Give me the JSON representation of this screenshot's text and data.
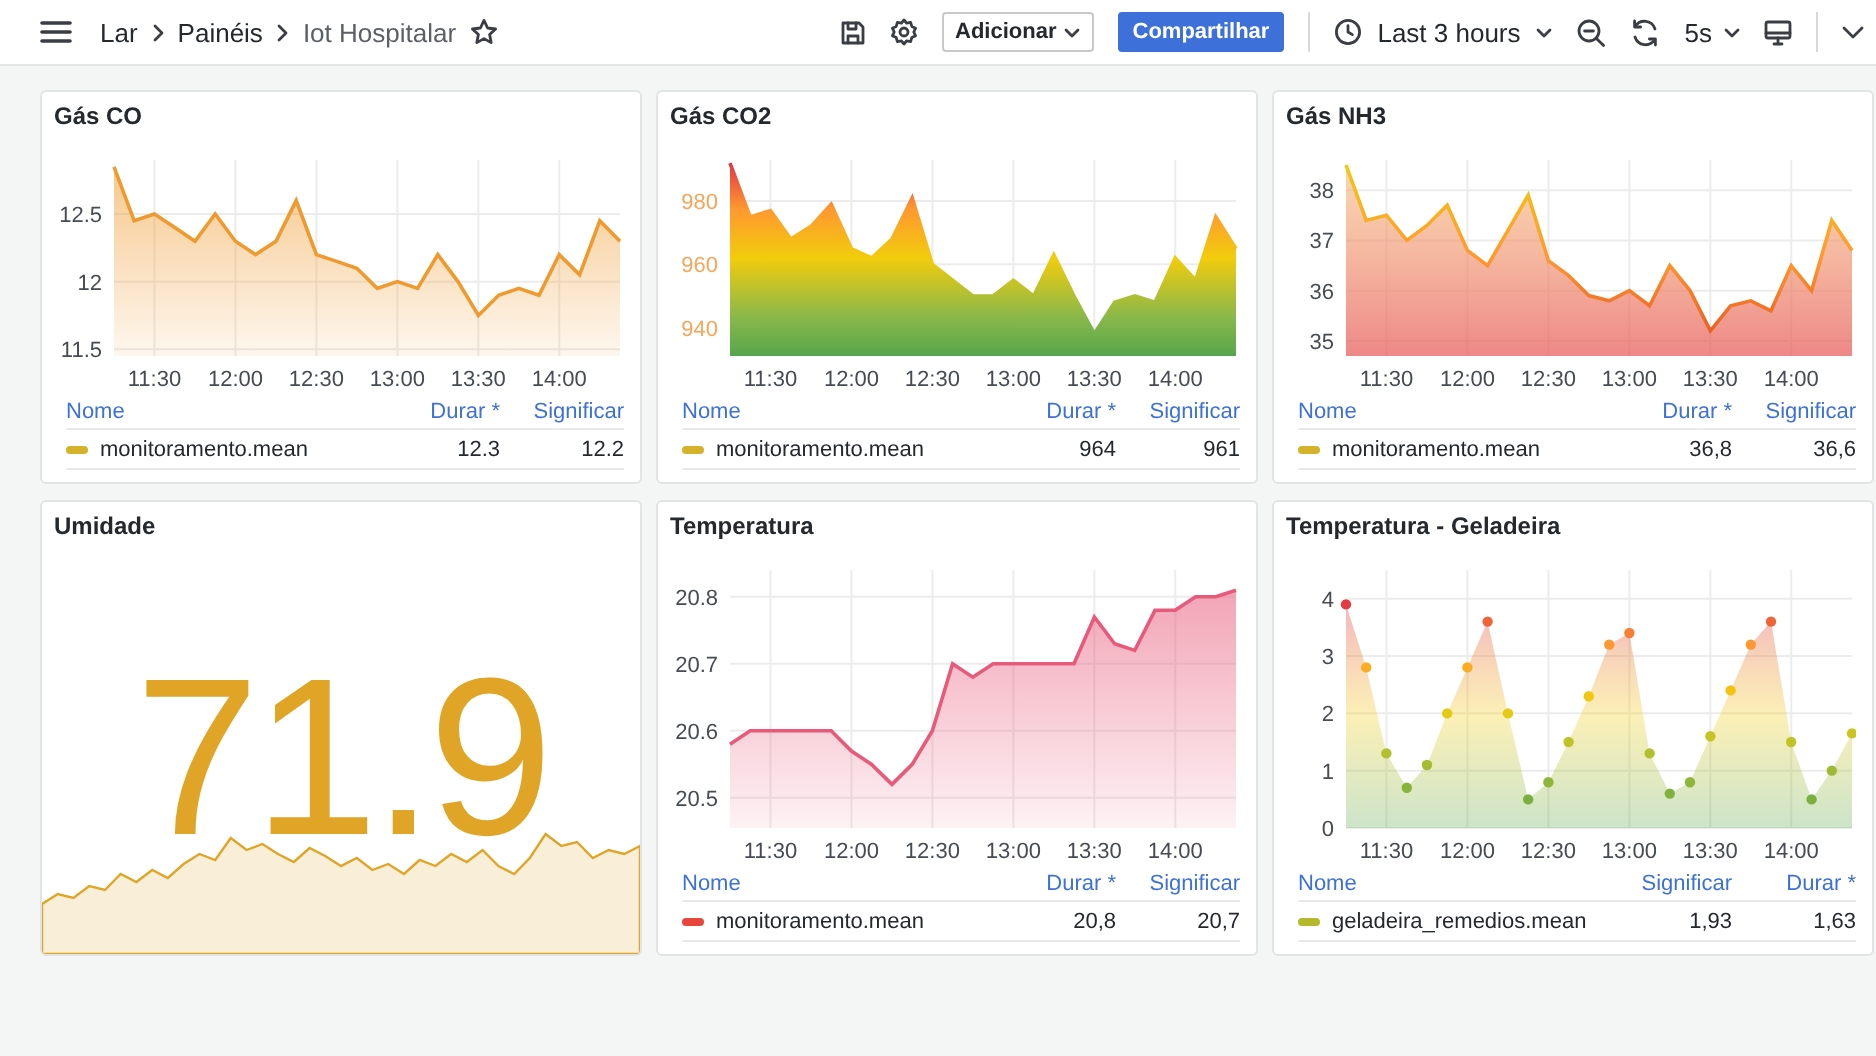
{
  "topbar": {
    "breadcrumbs": [
      {
        "label": "Lar",
        "current": false
      },
      {
        "label": "Painéis",
        "current": false
      },
      {
        "label": "Iot Hospitalar",
        "current": true
      }
    ],
    "add_button": "Adicionar",
    "share_button": "Compartilhar",
    "time_range": "Last 3 hours",
    "refresh_interval": "5s"
  },
  "panels": [
    {
      "kind": "area",
      "title": "Gás CO",
      "chart_data": {
        "type": "area",
        "categories": [
          null,
          null,
          "11:30",
          null,
          null,
          null,
          "12:00",
          null,
          null,
          null,
          "12:30",
          null,
          null,
          null,
          "13:00",
          null,
          null,
          null,
          "13:30",
          null,
          null,
          null,
          "14:00",
          null,
          null,
          null
        ],
        "series": [
          {
            "color": "#ef9a2f",
            "values": [
              12.85,
              12.45,
              12.5,
              12.4,
              12.3,
              12.5,
              12.3,
              12.2,
              12.3,
              12.6,
              12.2,
              12.15,
              12.1,
              11.95,
              12.0,
              11.95,
              12.2,
              12.0,
              11.75,
              11.9,
              11.95,
              11.9,
              12.2,
              12.05,
              12.45,
              12.3
            ]
          }
        ],
        "grid": true,
        "ylim": [
          11.45,
          12.9
        ],
        "yticks": [
          {
            "value": 11.5,
            "label": "11.5"
          },
          {
            "value": 12,
            "label": "12"
          },
          {
            "value": 12.5,
            "label": "12.5"
          }
        ]
      },
      "legend": {
        "columns": [
          "Nome",
          "Durar *",
          "Significar"
        ],
        "rows": [
          {
            "name": "monitoramento.mean",
            "color": "#d4b22a",
            "values": [
              "12.3",
              "12.2"
            ]
          }
        ]
      }
    },
    {
      "kind": "gradient",
      "title": "Gás CO2",
      "chart_data": {
        "type": "area",
        "categories": [
          null,
          null,
          "11:30",
          null,
          null,
          null,
          "12:00",
          null,
          null,
          null,
          "12:30",
          null,
          null,
          null,
          "13:00",
          null,
          null,
          null,
          "13:30",
          null,
          null,
          null,
          "14:00",
          null,
          null,
          null
        ],
        "series": [
          {
            "color": "#56a64b",
            "values": [
              992,
              975,
              977,
              968,
              972,
              979,
              965,
              962,
              968,
              981,
              960,
              955,
              950,
              950,
              955,
              950,
              963,
              950,
              938,
              948,
              950,
              948,
              962,
              955,
              975,
              965
            ]
          }
        ],
        "grid": true,
        "ylim": [
          931,
          993
        ],
        "yticks": [
          940,
          960,
          980
        ]
      },
      "legend": {
        "columns": [
          "Nome",
          "Durar *",
          "Significar"
        ],
        "rows": [
          {
            "name": "monitoramento.mean",
            "color": "#d4b22a",
            "values": [
              "964",
              "961"
            ]
          }
        ]
      }
    },
    {
      "kind": "gradient-line",
      "title": "Gás NH3",
      "chart_data": {
        "type": "area",
        "categories": [
          null,
          null,
          "11:30",
          null,
          null,
          null,
          "12:00",
          null,
          null,
          null,
          "12:30",
          null,
          null,
          null,
          "13:00",
          null,
          null,
          null,
          "13:30",
          null,
          null,
          null,
          "14:00",
          null,
          null,
          null
        ],
        "series": [
          {
            "color": "#e0501e",
            "values": [
              38.5,
              37.4,
              37.5,
              37.0,
              37.3,
              37.7,
              36.8,
              36.5,
              37.2,
              37.9,
              36.6,
              36.3,
              35.9,
              35.8,
              36.0,
              35.7,
              36.5,
              36.0,
              35.2,
              35.7,
              35.8,
              35.6,
              36.5,
              36.0,
              37.4,
              36.8
            ]
          }
        ],
        "grid": true,
        "ylim": [
          34.7,
          38.6
        ],
        "yticks": [
          35,
          36,
          37,
          38
        ]
      },
      "legend": {
        "columns": [
          "Nome",
          "Durar *",
          "Significar"
        ],
        "rows": [
          {
            "name": "monitoramento.mean",
            "color": "#d4b22a",
            "values": [
              "36,8",
              "36,6"
            ]
          }
        ]
      }
    },
    {
      "kind": "stat",
      "title": "Umidade",
      "value": "71.9",
      "color": "#e0a526"
    },
    {
      "kind": "area",
      "title": "Temperatura",
      "chart_data": {
        "type": "area",
        "categories": [
          null,
          null,
          "11:30",
          null,
          null,
          null,
          "12:00",
          null,
          null,
          null,
          "12:30",
          null,
          null,
          null,
          "13:00",
          null,
          null,
          null,
          "13:30",
          null,
          null,
          null,
          "14:00",
          null,
          null,
          null
        ],
        "series": [
          {
            "color": "#e85a7a",
            "values": [
              20.58,
              20.6,
              20.6,
              20.6,
              20.6,
              20.6,
              20.57,
              20.55,
              20.52,
              20.55,
              20.6,
              20.7,
              20.68,
              20.7,
              20.7,
              20.7,
              20.7,
              20.7,
              20.77,
              20.73,
              20.72,
              20.78,
              20.78,
              20.8,
              20.8,
              20.81
            ]
          }
        ],
        "grid": true,
        "ylim": [
          20.455,
          20.84
        ],
        "yticks": [
          {
            "value": 20.5,
            "label": "20.5"
          },
          {
            "value": 20.6,
            "label": "20.6"
          },
          {
            "value": 20.7,
            "label": "20.7"
          },
          {
            "value": 20.8,
            "label": "20.8"
          }
        ]
      },
      "legend": {
        "columns": [
          "Nome",
          "Durar *",
          "Significar"
        ],
        "rows": [
          {
            "name": "monitoramento.mean",
            "color": "#e8463c",
            "values": [
              "20,8",
              "20,7"
            ]
          }
        ]
      }
    },
    {
      "kind": "points",
      "title": "Temperatura - Geladeira",
      "chart_data": {
        "type": "area",
        "categories": [
          null,
          null,
          "11:30",
          null,
          null,
          null,
          "12:00",
          null,
          null,
          null,
          "12:30",
          null,
          null,
          null,
          "13:00",
          null,
          null,
          null,
          "13:30",
          null,
          null,
          null,
          "14:00",
          null,
          null,
          null
        ],
        "series": [
          {
            "color": "#56a64b",
            "values": [
              3.9,
              2.8,
              1.3,
              0.7,
              1.1,
              2.0,
              2.8,
              3.6,
              2.0,
              0.5,
              0.8,
              1.5,
              2.3,
              3.2,
              3.4,
              1.3,
              0.6,
              0.8,
              1.6,
              2.4,
              3.2,
              3.6,
              1.5,
              0.5,
              1.0,
              1.65
            ]
          }
        ],
        "grid": true,
        "ylim": [
          0,
          4.5
        ],
        "yticks": [
          0,
          1,
          2,
          3,
          4
        ]
      },
      "legend": {
        "columns": [
          "Nome",
          "Significar",
          "Durar *"
        ],
        "rows": [
          {
            "name": "geladeira_remedios.mean",
            "color": "#b5b82a",
            "values": [
              "1,93",
              "1,63"
            ]
          }
        ]
      }
    }
  ]
}
